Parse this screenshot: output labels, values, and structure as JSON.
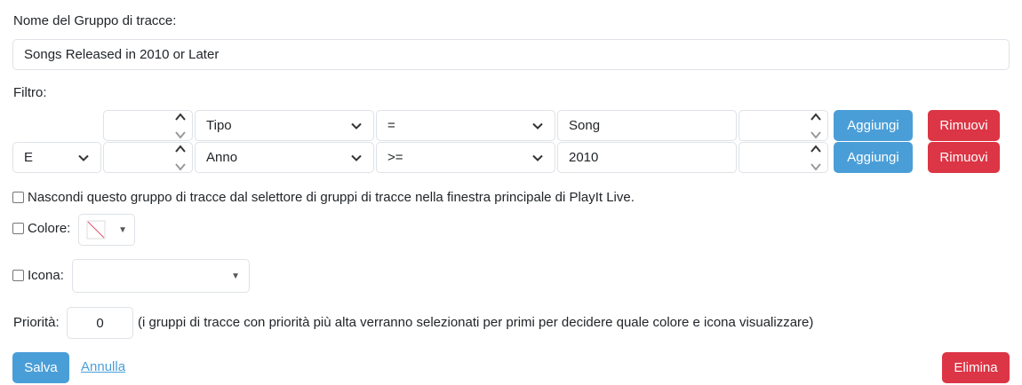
{
  "group_name": {
    "label": "Nome del Gruppo di tracce:",
    "value": "Songs Released in 2010 or Later"
  },
  "filter": {
    "label": "Filtro:",
    "rows": [
      {
        "conjunction": "",
        "field": "Tipo",
        "operator": "=",
        "value": "Song",
        "add_label": "Aggiungi",
        "remove_label": "Rimuovi"
      },
      {
        "conjunction": "E",
        "field": "Anno",
        "operator": ">=",
        "value": "2010",
        "add_label": "Aggiungi",
        "remove_label": "Rimuovi"
      }
    ]
  },
  "hide_option": {
    "label": "Nascondi questo gruppo di tracce dal selettore di gruppi di tracce nella finestra principale di PlayIt Live."
  },
  "color_option": {
    "label": "Colore:",
    "caret": "▼"
  },
  "icon_option": {
    "label": "Icona:",
    "caret": "▼"
  },
  "priority": {
    "label": "Priorità:",
    "value": "0",
    "hint": "(i gruppi di tracce con priorità più alta verranno selezionati per primi per decidere quale colore e icona visualizzare)"
  },
  "actions": {
    "save_label": "Salva",
    "cancel_label": "Annulla",
    "delete_label": "Elimina"
  },
  "colors": {
    "primary": "#4a9ed8",
    "danger": "#dc3545",
    "border": "#dee2e6"
  }
}
